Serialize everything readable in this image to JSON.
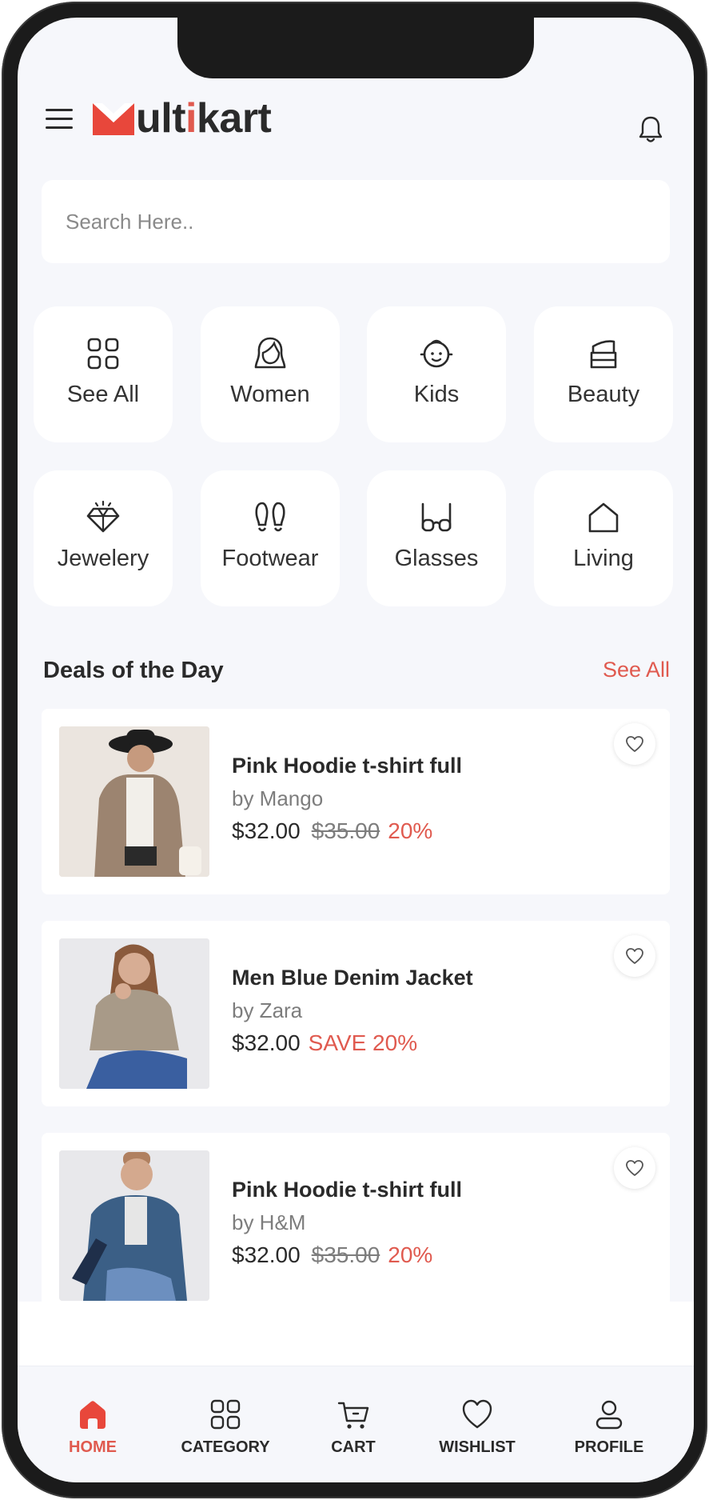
{
  "app": {
    "logo_mark": "M",
    "logo_text_main": "ulti",
    "logo_text_accent": "kart",
    "brand_color": "#e05a4f"
  },
  "header": {
    "menu_icon": "hamburger-menu-icon",
    "notification_icon": "bell-icon"
  },
  "search": {
    "placeholder": "Search Here.."
  },
  "categories": [
    {
      "label": "See All",
      "icon": "grid-icon"
    },
    {
      "label": "Women",
      "icon": "woman-icon"
    },
    {
      "label": "Kids",
      "icon": "kid-icon"
    },
    {
      "label": "Beauty",
      "icon": "cosmetics-icon"
    },
    {
      "label": "Jewelery",
      "icon": "diamond-icon"
    },
    {
      "label": "Footwear",
      "icon": "footprints-icon"
    },
    {
      "label": "Glasses",
      "icon": "glasses-icon"
    },
    {
      "label": "Living",
      "icon": "house-icon"
    }
  ],
  "deals": {
    "title": "Deals of the Day",
    "see_all": "See All",
    "items": [
      {
        "name": "Pink Hoodie t-shirt full",
        "brand": "by Mango",
        "price": "$32.00",
        "old_price": "$35.00",
        "discount": "20%"
      },
      {
        "name": "Men Blue Denim Jacket",
        "brand": "by Zara",
        "price": "$32.00",
        "save": "SAVE 20%"
      },
      {
        "name": "Pink Hoodie t-shirt full",
        "brand": "by H&M",
        "price": "$32.00",
        "old_price": "$35.00",
        "discount": "20%"
      }
    ]
  },
  "nav": [
    {
      "label": "HOME",
      "icon": "home-icon",
      "active": true
    },
    {
      "label": "CATEGORY",
      "icon": "grid-icon",
      "active": false
    },
    {
      "label": "CART",
      "icon": "cart-icon",
      "active": false
    },
    {
      "label": "WISHLIST",
      "icon": "heart-icon",
      "active": false
    },
    {
      "label": "PROFILE",
      "icon": "user-icon",
      "active": false
    }
  ]
}
